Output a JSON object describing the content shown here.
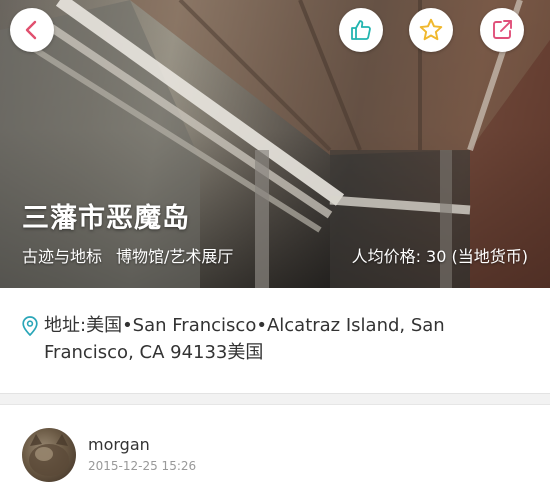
{
  "header": {
    "title": "三藩市恶魔岛",
    "tags": [
      "古迹与地标",
      "博物馆/艺术展厅"
    ],
    "price": "人均价格: 30 (当地货币)"
  },
  "icons": {
    "back": "chevron-left-icon",
    "like": "thumbs-up-icon",
    "favorite": "star-icon",
    "share": "share-icon",
    "location": "location-pin-icon"
  },
  "colors": {
    "back": "#e0506e",
    "like": "#22b5b0",
    "favorite": "#f0b82e",
    "share": "#e0507a",
    "pin": "#2aa6b8"
  },
  "address": {
    "text": "地址:美国•San Francisco•Alcatraz Island, San Francisco, CA 94133美国"
  },
  "comment": {
    "username": "morgan",
    "timestamp": "2015-12-25 15:26"
  }
}
